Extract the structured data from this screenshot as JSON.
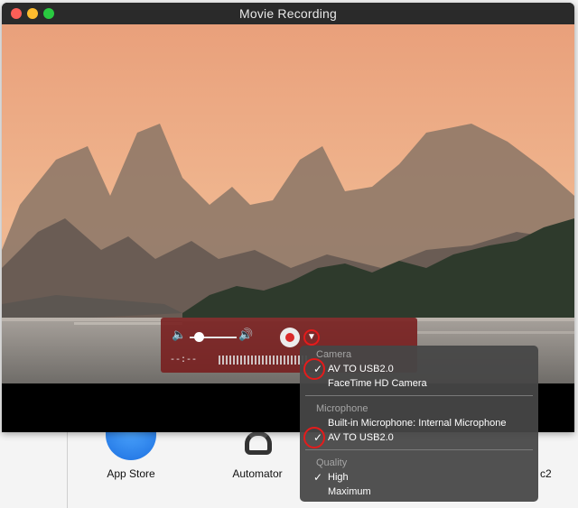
{
  "window": {
    "title": "Movie Recording"
  },
  "controls": {
    "timecode": "--:--",
    "volume_low_icon": "speaker-low-icon",
    "volume_high_icon": "speaker-high-icon",
    "volume_level": 0.1,
    "record_icon": "record-icon",
    "options_icon": "chevron-down-icon"
  },
  "menu": {
    "camera_header": "Camera",
    "camera_items": [
      "AV TO USB2.0",
      "FaceTime HD Camera"
    ],
    "camera_selected": 0,
    "microphone_header": "Microphone",
    "microphone_items": [
      "Built-in Microphone: Internal Microphone",
      "AV TO USB2.0"
    ],
    "microphone_selected": 1,
    "quality_header": "Quality",
    "quality_items": [
      "High",
      "Maximum"
    ],
    "quality_selected": 0,
    "check_glyph": "✓"
  },
  "desktop": {
    "apps": [
      "App Store",
      "Automator"
    ],
    "partial_label": "c2"
  },
  "colors": {
    "sky_top": "#e8a07a",
    "mountain": "#6e6055",
    "record_red": "#d92a2a",
    "highlight_circle": "#e51b1b"
  }
}
